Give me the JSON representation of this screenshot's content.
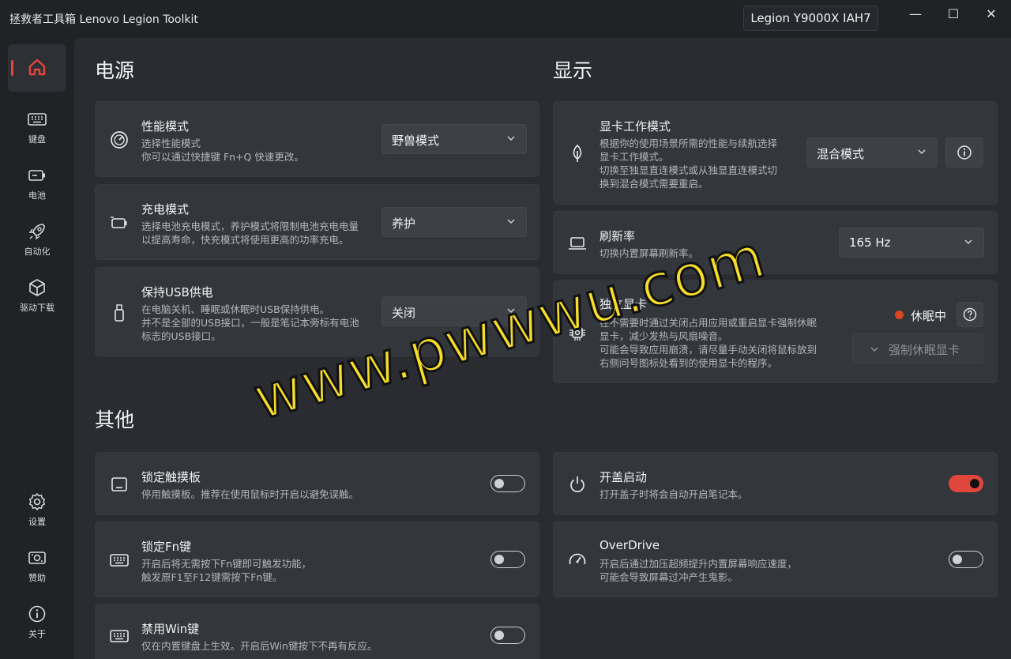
{
  "app": {
    "title": "拯救者工具箱 Lenovo Legion Toolkit",
    "device": "Legion Y9000X IAH7"
  },
  "window": {
    "minimize": "—",
    "maximize": "☐",
    "close": "✕"
  },
  "nav": {
    "items": [
      {
        "label": "",
        "icon": "home-icon"
      },
      {
        "label": "键盘",
        "icon": "keyboard-icon"
      },
      {
        "label": "电池",
        "icon": "battery-icon"
      },
      {
        "label": "自动化",
        "icon": "rocket-icon"
      },
      {
        "label": "驱动下载",
        "icon": "box-icon"
      },
      {
        "label": "设置",
        "icon": "gear-icon"
      },
      {
        "label": "赞助",
        "icon": "donate-icon"
      },
      {
        "label": "关于",
        "icon": "info-icon"
      }
    ]
  },
  "sections": {
    "power": "电源",
    "display": "显示",
    "other": "其他"
  },
  "power": {
    "perf": {
      "title": "性能模式",
      "desc1": "选择性能模式",
      "desc2": "你可以通过快捷键 Fn+Q 快速更改。",
      "value": "野兽模式"
    },
    "charge": {
      "title": "充电模式",
      "desc1": "选择电池充电模式，养护模式将限制电池充电电量",
      "desc2": "以提高寿命，快充模式将使用更高的功率充电。",
      "value": "养护"
    },
    "usb": {
      "title": "保持USB供电",
      "desc1": "在电脑关机、睡眠或休眠时USB保持供电。",
      "desc2": "并不是全部的USB接口，一般是笔记本旁标有电池",
      "desc3": "标志的USB接口。",
      "value": "关闭"
    }
  },
  "display": {
    "gpu": {
      "title": "显卡工作模式",
      "desc1": "根据你的使用场景所需的性能与续航选择",
      "desc2": "显卡工作模式。",
      "desc3": "切换至独显直连模式或从独显直连模式切",
      "desc4": "换到混合模式需要重启。",
      "value": "混合模式"
    },
    "refresh": {
      "title": "刷新率",
      "desc1": "切换内置屏幕刷新率。",
      "value": "165 Hz"
    },
    "dgpu": {
      "title": "独立显卡",
      "desc1": "在不需要时通过关闭占用应用或重启显卡强制休眠",
      "desc2": "显卡，减少发热与风扇噪音。",
      "desc3": "可能会导致应用崩溃，请尽量手动关闭将鼠标放到",
      "desc4": "右侧问号图标处看到的使用显卡的程序。",
      "status": "休眠中",
      "status_color": "#d9461f",
      "action": "强制休眠显卡"
    }
  },
  "other": {
    "touchpad": {
      "title": "锁定触摸板",
      "desc1": "停用触摸板。推荐在使用鼠标时开启以避免误触。",
      "on": false
    },
    "fnlock": {
      "title": "锁定Fn键",
      "desc1": "开启后将无需按下Fn键即可触发功能，",
      "desc2": "触发原F1至F12键需按下Fn键。",
      "on": false
    },
    "winkey": {
      "title": "禁用Win键",
      "desc1": "仅在内置键盘上生效。开启后Win键按下不再有反应。",
      "on": false
    },
    "lidpower": {
      "title": "开盖启动",
      "desc1": "打开盖子时将会自动开启笔记本。",
      "on": true
    },
    "overdrive": {
      "title": "OverDrive",
      "desc1": "开启后通过加压超频提升内置屏幕响应速度，",
      "desc2": "可能会导致屏幕过冲产生鬼影。",
      "on": false
    }
  },
  "watermark": "www.pwwwu.com",
  "accent": "#e0463c"
}
